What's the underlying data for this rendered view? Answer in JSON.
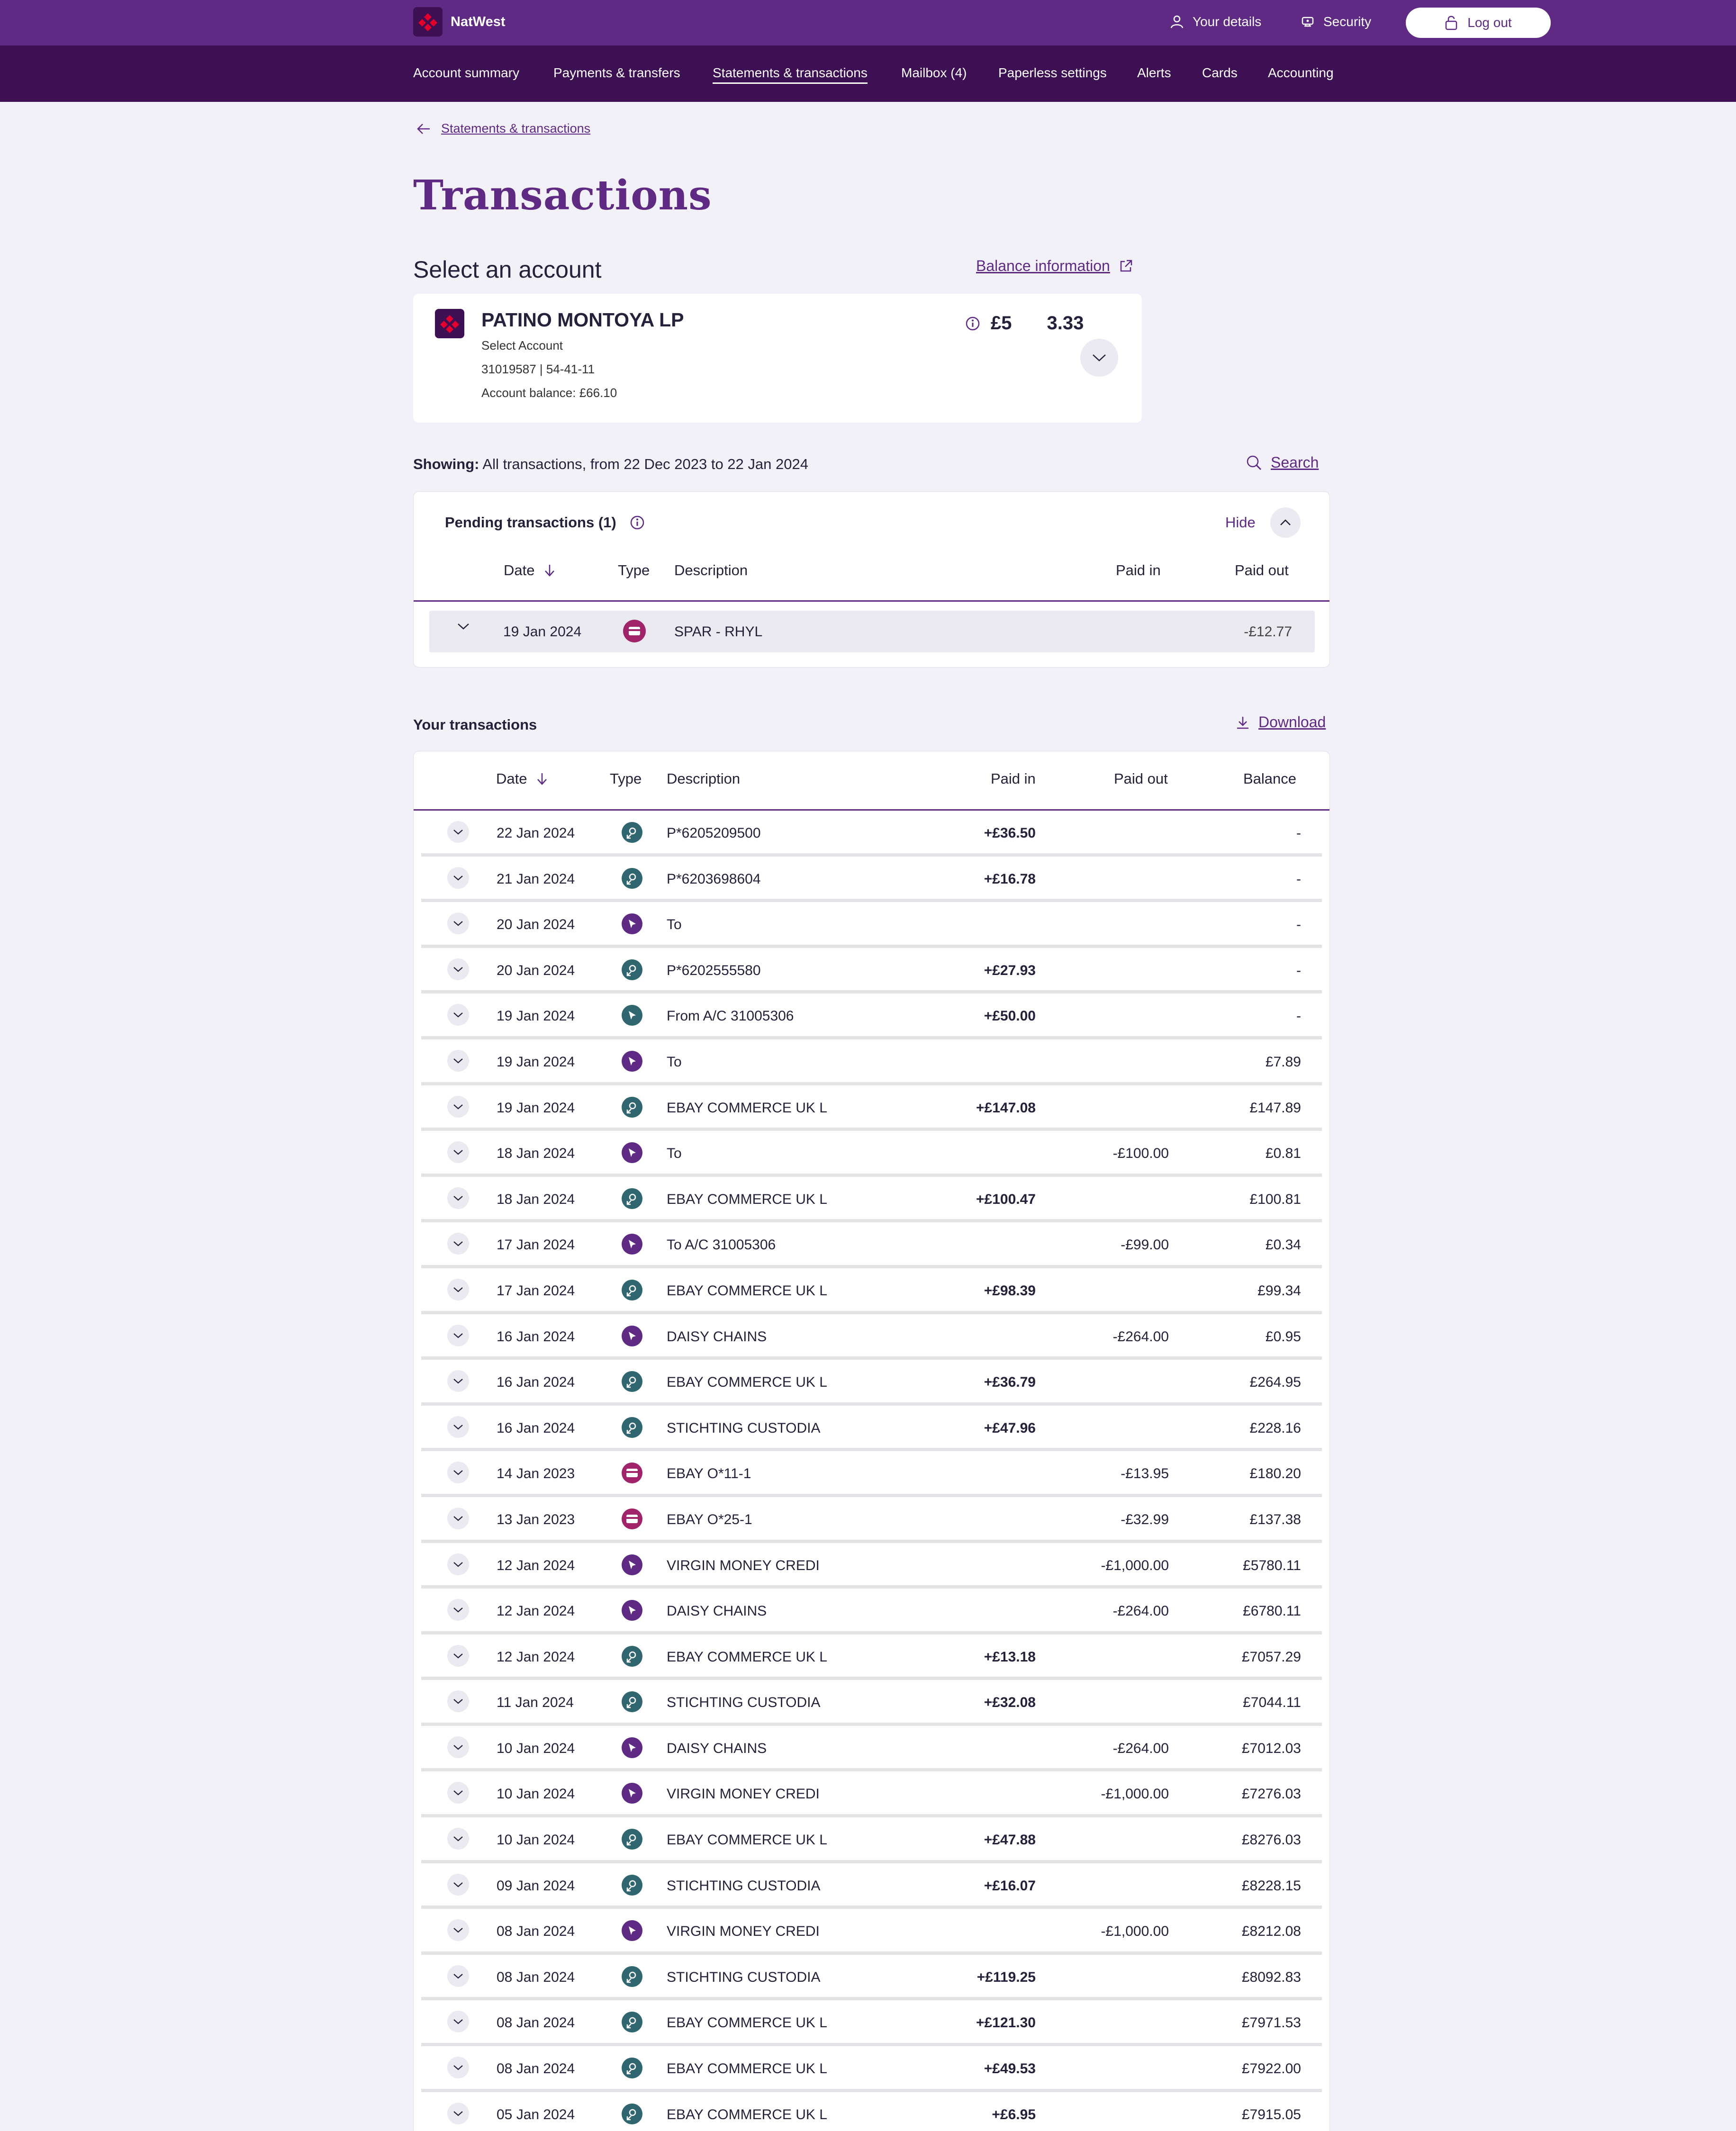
{
  "header": {
    "brand": "NatWest",
    "your_details": "Your details",
    "security": "Security",
    "logout": "Log out"
  },
  "nav": {
    "items": [
      "Account summary",
      "Payments & transfers",
      "Statements & transactions",
      "Mailbox (4)",
      "Paperless settings",
      "Alerts",
      "Cards",
      "Accounting"
    ],
    "active": "Statements & transactions"
  },
  "breadcrumb": {
    "back_label": "Statements & transactions"
  },
  "page": {
    "title": "Transactions",
    "select_account_title": "Select an account",
    "balance_information": "Balance information"
  },
  "account": {
    "name": "PATINO MONTOYA LP",
    "select_label": "Select Account",
    "number_sort": "31019587 | 54-41-11",
    "balance_line": "Account balance: £66.10",
    "amount_part1": "£5",
    "amount_part2": "3.33"
  },
  "filter": {
    "showing_label": "Showing:",
    "showing_text": "All transactions, from 22 Dec 2023 to 22 Jan 2024",
    "search": "Search"
  },
  "pending": {
    "title": "Pending transactions (1)",
    "hide": "Hide",
    "columns": {
      "date": "Date",
      "type": "Type",
      "description": "Description",
      "paid_in": "Paid in",
      "paid_out": "Paid out"
    },
    "rows": [
      {
        "date": "19 Jan 2024",
        "type_icon": "card-icon",
        "description": "SPAR - RHYL",
        "paid_in": "",
        "paid_out": "-£12.77"
      }
    ]
  },
  "transactions": {
    "title": "Your transactions",
    "download": "Download",
    "columns": {
      "date": "Date",
      "type": "Type",
      "description": "Description",
      "paid_in": "Paid in",
      "paid_out": "Paid out",
      "balance": "Balance"
    },
    "rows": [
      {
        "date": "22 Jan 2024",
        "type": "payin",
        "description": "P*6205209500",
        "paid_in": "+£36.50",
        "paid_out": "",
        "balance": "-"
      },
      {
        "date": "21 Jan 2024",
        "type": "payin",
        "description": "P*6203698604",
        "paid_in": "+£16.78",
        "paid_out": "",
        "balance": "-"
      },
      {
        "date": "20 Jan 2024",
        "type": "transfer",
        "description": "To",
        "paid_in": "",
        "paid_out": "",
        "balance": "-"
      },
      {
        "date": "20 Jan 2024",
        "type": "payin",
        "description": "P*6202555580",
        "paid_in": "+£27.93",
        "paid_out": "",
        "balance": "-"
      },
      {
        "date": "19 Jan 2024",
        "type": "transfer-in",
        "description": "From A/C 31005306",
        "paid_in": "+£50.00",
        "paid_out": "",
        "balance": "-"
      },
      {
        "date": "19 Jan 2024",
        "type": "transfer",
        "description": "To",
        "paid_in": "",
        "paid_out": "",
        "balance": "£7.89"
      },
      {
        "date": "19 Jan 2024",
        "type": "payin",
        "description": "EBAY COMMERCE UK L",
        "paid_in": "+£147.08",
        "paid_out": "",
        "balance": "£147.89"
      },
      {
        "date": "18 Jan 2024",
        "type": "transfer",
        "description": "To",
        "paid_in": "",
        "paid_out": "-£100.00",
        "balance": "£0.81"
      },
      {
        "date": "18 Jan 2024",
        "type": "payin",
        "description": "EBAY COMMERCE UK L",
        "paid_in": "+£100.47",
        "paid_out": "",
        "balance": "£100.81"
      },
      {
        "date": "17 Jan 2024",
        "type": "transfer",
        "description": "To A/C 31005306",
        "paid_in": "",
        "paid_out": "-£99.00",
        "balance": "£0.34"
      },
      {
        "date": "17 Jan 2024",
        "type": "payin",
        "description": "EBAY COMMERCE UK L",
        "paid_in": "+£98.39",
        "paid_out": "",
        "balance": "£99.34"
      },
      {
        "date": "16 Jan 2024",
        "type": "transfer",
        "description": "DAISY CHAINS",
        "paid_in": "",
        "paid_out": "-£264.00",
        "balance": "£0.95"
      },
      {
        "date": "16 Jan 2024",
        "type": "payin",
        "description": "EBAY COMMERCE UK L",
        "paid_in": "+£36.79",
        "paid_out": "",
        "balance": "£264.95"
      },
      {
        "date": "16 Jan 2024",
        "type": "payin",
        "description": "STICHTING CUSTODIA",
        "paid_in": "+£47.96",
        "paid_out": "",
        "balance": "£228.16"
      },
      {
        "date": "14 Jan  2023",
        "type": "card",
        "description": "EBAY O*11-1",
        "paid_in": "",
        "paid_out": "-£13.95",
        "balance": "£180.20"
      },
      {
        "date": "13 Jan  2023",
        "type": "card",
        "description": "EBAY O*25-1",
        "paid_in": "",
        "paid_out": "-£32.99",
        "balance": "£137.38"
      },
      {
        "date": "12 Jan 2024",
        "type": "transfer",
        "description": "VIRGIN MONEY CREDI",
        "paid_in": "",
        "paid_out": "-£1,000.00",
        "balance": "£5780.11"
      },
      {
        "date": "12 Jan 2024",
        "type": "transfer",
        "description": "DAISY CHAINS",
        "paid_in": "",
        "paid_out": "-£264.00",
        "balance": "£6780.11"
      },
      {
        "date": "12 Jan 2024",
        "type": "payin",
        "description": "EBAY COMMERCE UK L",
        "paid_in": "+£13.18",
        "paid_out": "",
        "balance": "£7057.29"
      },
      {
        "date": "11 Jan 2024",
        "type": "payin",
        "description": "STICHTING CUSTODIA",
        "paid_in": "+£32.08",
        "paid_out": "",
        "balance": "£7044.11"
      },
      {
        "date": "10 Jan 2024",
        "type": "transfer",
        "description": "DAISY CHAINS",
        "paid_in": "",
        "paid_out": "-£264.00",
        "balance": "£7012.03"
      },
      {
        "date": "10 Jan 2024",
        "type": "transfer",
        "description": "VIRGIN MONEY CREDI",
        "paid_in": "",
        "paid_out": "-£1,000.00",
        "balance": "£7276.03"
      },
      {
        "date": "10 Jan 2024",
        "type": "payin",
        "description": "EBAY COMMERCE UK L",
        "paid_in": "+£47.88",
        "paid_out": "",
        "balance": "£8276.03"
      },
      {
        "date": "09 Jan 2024",
        "type": "payin",
        "description": "STICHTING CUSTODIA",
        "paid_in": "+£16.07",
        "paid_out": "",
        "balance": "£8228.15"
      },
      {
        "date": "08 Jan 2024",
        "type": "transfer",
        "description": "VIRGIN MONEY CREDI",
        "paid_in": "",
        "paid_out": "-£1,000.00",
        "balance": "£8212.08"
      },
      {
        "date": "08 Jan 2024",
        "type": "payin",
        "description": "STICHTING CUSTODIA",
        "paid_in": "+£119.25",
        "paid_out": "",
        "balance": "£8092.83"
      },
      {
        "date": "08 Jan 2024",
        "type": "payin",
        "description": "EBAY COMMERCE UK L",
        "paid_in": "+£121.30",
        "paid_out": "",
        "balance": "£7971.53"
      },
      {
        "date": "08 Jan 2024",
        "type": "payin",
        "description": "EBAY COMMERCE UK L",
        "paid_in": "+£49.53",
        "paid_out": "",
        "balance": "£7922.00"
      },
      {
        "date": "05 Jan 2024",
        "type": "payin",
        "description": "EBAY COMMERCE UK L",
        "paid_in": "+£6.95",
        "paid_out": "",
        "balance": "£7915.05"
      }
    ]
  },
  "colors": {
    "brand_purple": "#5e2a84",
    "nav_purple": "#3c1053",
    "payin_teal": "#2f6670",
    "card_magenta": "#a1246b",
    "page_bg": "#f3f1f8"
  }
}
